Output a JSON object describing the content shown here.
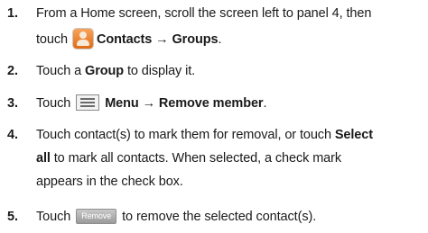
{
  "steps": [
    {
      "num": "1.",
      "lines": [
        "From a Home screen, scroll the screen left to panel 4, then",
        "touch",
        "Contacts → Groups",
        "."
      ]
    },
    {
      "num": "2.",
      "pre": "Touch a ",
      "bold": "Group",
      "post": " to display it."
    },
    {
      "num": "3.",
      "pre": "Touch",
      "bold": "Menu → Remove member",
      "post": "."
    },
    {
      "num": "4.",
      "line1_pre": "Touch contact(s) to mark them for removal, or touch ",
      "line1_bold": "Select",
      "line2_bold": "all",
      "line2_post": " to mark all contacts. When selected, a check mark",
      "line3": "appears in the check box."
    },
    {
      "num": "5.",
      "pre": "Touch",
      "button": "Remove",
      "post": "to remove the selected contact(s)."
    }
  ],
  "icons": {
    "contacts": "contacts-app-icon",
    "menu": "menu-key-icon"
  }
}
